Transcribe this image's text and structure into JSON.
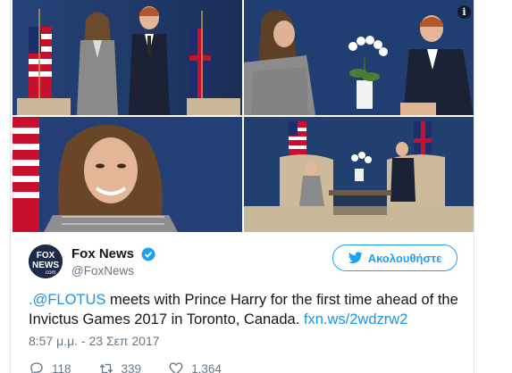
{
  "tweet": {
    "author": {
      "display_name": "Fox News",
      "screen_name": "@FoxNews",
      "avatar_text_top": "FOX",
      "avatar_text_mid": "NEWS",
      "avatar_text_bot": ".com",
      "verified": true
    },
    "follow_label": "Ακολουθήστε",
    "text": {
      "mention": ".@FLOTUS",
      "body": " meets with Prince Harry for the first time ahead of the Invictus Games 2017 in Toronto, Canada. ",
      "link": "fxn.ws/2wdzrw2"
    },
    "timestamp": "8:57 μ.μ. - 23 Σεπ 2017",
    "actions": {
      "replies": "118",
      "retweets": "339",
      "likes": "1.364"
    },
    "media_info_label": "i"
  },
  "colors": {
    "accent": "#1da1f2",
    "link": "#1b95e0",
    "muted": "#657786",
    "text": "#14171a"
  }
}
